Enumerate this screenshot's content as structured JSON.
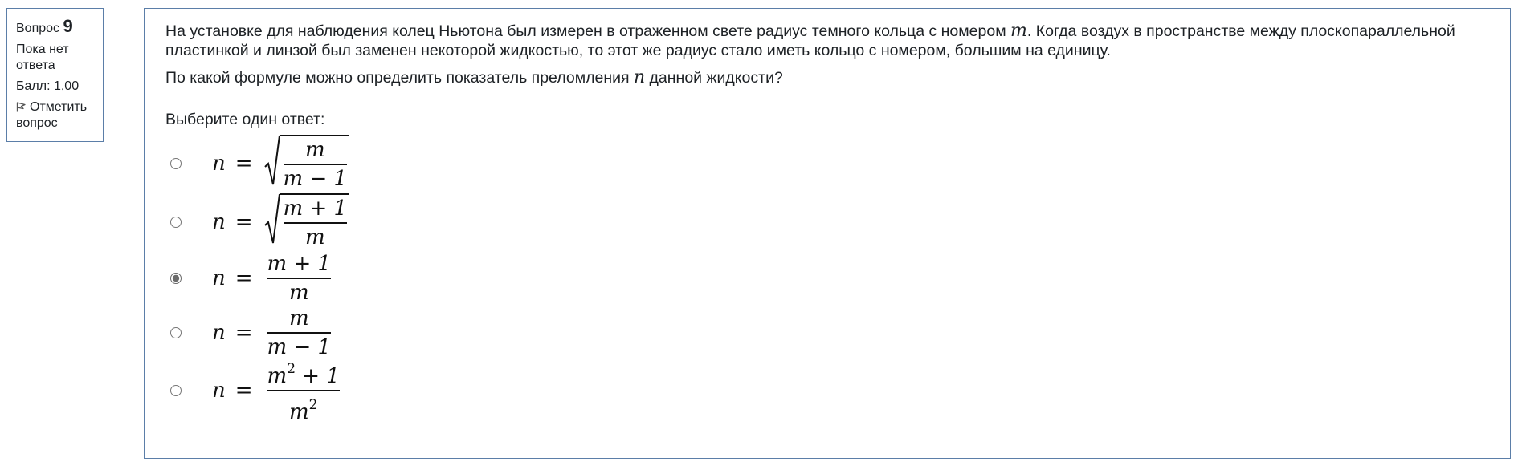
{
  "info": {
    "question_word": "Вопрос",
    "question_number": "9",
    "state_text": "Пока нет ответа",
    "grade_text": "Балл: 1,00",
    "flag_label": "Отметить вопрос"
  },
  "question": {
    "paragraph1_part1": "На установке для наблюдения колец Ньютона был измерен в отраженном свете радиус темного кольца с номером ",
    "paragraph1_var": "m",
    "paragraph1_part2": ". Когда воздух в пространстве между плоскопараллельной пластинкой и линзой был заменен некоторой жидкостью, то этот же радиус стало иметь кольцо с номером, большим на единицу.",
    "paragraph2_part1": "По какой формуле можно определить показатель преломления ",
    "paragraph2_var": "n",
    "paragraph2_part2": " данной жидкости?"
  },
  "prompt": "Выберите один ответ:",
  "answers": [
    {
      "lhs": "n",
      "eq": "=",
      "sqrt": true,
      "num": "m",
      "den": "m − 1",
      "selected": false
    },
    {
      "lhs": "n",
      "eq": "=",
      "sqrt": true,
      "num": "m + 1",
      "den": "m",
      "selected": false
    },
    {
      "lhs": "n",
      "eq": "=",
      "sqrt": false,
      "num": "m + 1",
      "den": "m",
      "selected": true
    },
    {
      "lhs": "n",
      "eq": "=",
      "sqrt": false,
      "num": "m",
      "den": "m − 1",
      "selected": false
    },
    {
      "lhs": "n",
      "eq": "=",
      "sqrt": false,
      "num_base": "m",
      "num_exp": "2",
      "num_rest": " + 1",
      "den_base": "m",
      "den_exp": "2",
      "selected": false
    }
  ]
}
